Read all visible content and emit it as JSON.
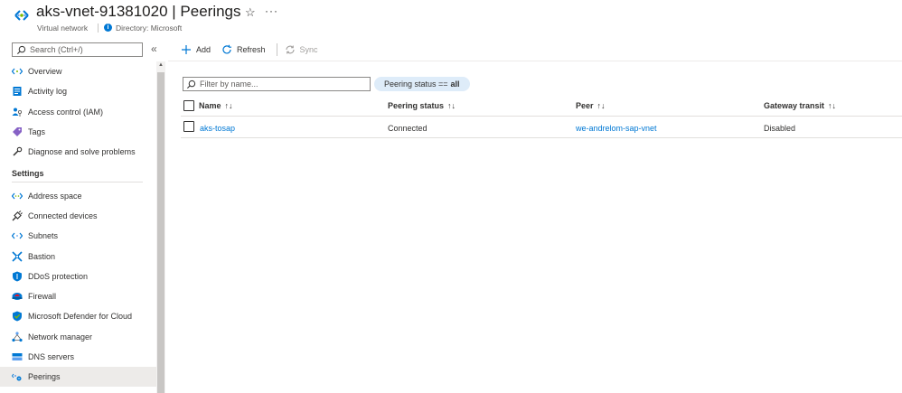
{
  "header": {
    "title": "aks-vnet-91381020 | Peerings",
    "resource_type": "Virtual network",
    "directory": "Directory: Microsoft",
    "favorite_icon": "star-icon",
    "more_label": "···"
  },
  "sidebar": {
    "search_placeholder": "Search (Ctrl+/)",
    "collapse_label": "«",
    "items": [
      {
        "label": "Overview",
        "icon": "overview-icon"
      },
      {
        "label": "Activity log",
        "icon": "activity-log-icon"
      },
      {
        "label": "Access control (IAM)",
        "icon": "iam-icon"
      },
      {
        "label": "Tags",
        "icon": "tag-icon"
      },
      {
        "label": "Diagnose and solve problems",
        "icon": "wrench-icon"
      }
    ],
    "settings_header": "Settings",
    "settings_items": [
      {
        "label": "Address space",
        "icon": "address-space-icon"
      },
      {
        "label": "Connected devices",
        "icon": "plug-icon"
      },
      {
        "label": "Subnets",
        "icon": "subnets-icon"
      },
      {
        "label": "Bastion",
        "icon": "bastion-icon"
      },
      {
        "label": "DDoS protection",
        "icon": "shield-icon"
      },
      {
        "label": "Firewall",
        "icon": "firewall-icon"
      },
      {
        "label": "Microsoft Defender for Cloud",
        "icon": "defender-icon"
      },
      {
        "label": "Network manager",
        "icon": "network-manager-icon"
      },
      {
        "label": "DNS servers",
        "icon": "dns-icon"
      },
      {
        "label": "Peerings",
        "icon": "peerings-icon",
        "active": true
      }
    ]
  },
  "toolbar": {
    "add_label": "Add",
    "refresh_label": "Refresh",
    "sync_label": "Sync"
  },
  "filters": {
    "name_placeholder": "Filter by name...",
    "status_pill_prefix": "Peering status ==",
    "status_pill_value": "all"
  },
  "table": {
    "columns": [
      "Name",
      "Peering status",
      "Peer",
      "Gateway transit"
    ],
    "sort_glyph": "↑↓",
    "rows": [
      {
        "name": "aks-tosap",
        "status": "Connected",
        "peer": "we-andrelom-sap-vnet",
        "gateway_transit": "Disabled"
      }
    ]
  },
  "colors": {
    "accent": "#0078d4",
    "pill_bg": "#deecf9",
    "active_nav_bg": "#edebe9"
  }
}
